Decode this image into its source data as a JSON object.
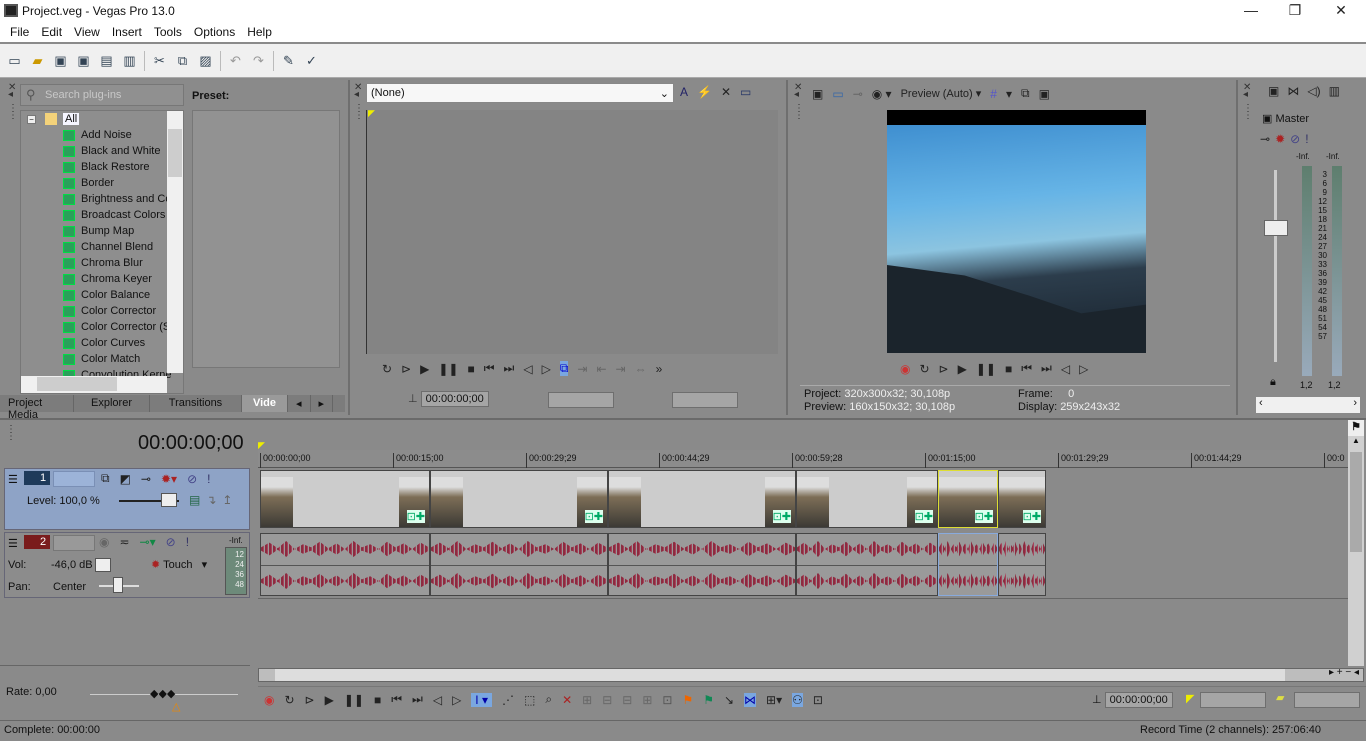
{
  "window": {
    "title": "Project.veg - Vegas Pro 13.0",
    "min": "—",
    "max": "❐",
    "close": "✕"
  },
  "menu": [
    "File",
    "Edit",
    "View",
    "Insert",
    "Tools",
    "Options",
    "Help"
  ],
  "toolbar_icons": [
    "new-icon",
    "open-icon",
    "save-icon",
    "save-as-icon",
    "render-icon",
    "properties-icon",
    "cut-icon",
    "copy-icon",
    "paste-icon",
    "undo-icon",
    "redo-icon",
    "enable-snapping-icon",
    "auto-ripple-icon"
  ],
  "plugins": {
    "search_placeholder": "Search plug-ins",
    "preset_label": "Preset:",
    "root": "All",
    "items": [
      "Add Noise",
      "Black and White",
      "Black Restore",
      "Border",
      "Brightness and Co",
      "Broadcast Colors",
      "Bump Map",
      "Channel Blend",
      "Chroma Blur",
      "Chroma Keyer",
      "Color Balance",
      "Color Corrector",
      "Color Corrector (S",
      "Color Curves",
      "Color Match",
      "Convolution Kerne"
    ]
  },
  "dock_tabs": [
    "Project Media",
    "Explorer",
    "Transitions",
    "Vide"
  ],
  "trimmer": {
    "selection": "(None)",
    "timecode": "00:00:00;00"
  },
  "preview": {
    "mode": "Preview (Auto)",
    "project_label": "Project:",
    "project": "320x300x32; 30,108p",
    "preview_label": "Preview:",
    "preview": "160x150x32; 30,108p",
    "frame_label": "Frame:",
    "frame": "0",
    "display_label": "Display:",
    "display": "259x243x32"
  },
  "master": {
    "label": "Master",
    "inf_left": "-Inf.",
    "inf_right": "-Inf.",
    "scale": [
      "3",
      "6",
      "9",
      "12",
      "15",
      "18",
      "21",
      "24",
      "27",
      "30",
      "33",
      "36",
      "39",
      "42",
      "45",
      "48",
      "51",
      "54",
      "57"
    ],
    "bottom_left": "1,2",
    "bottom_right": "1,2"
  },
  "timeline": {
    "cursor_time": "00:00:00;00",
    "ruler": [
      "00:00:00;00",
      "00:00:15;00",
      "00:00:29;29",
      "00:00:44;29",
      "00:00:59;28",
      "00:01:15;00",
      "00:01:29;29",
      "00:01:44;29",
      "00:0"
    ],
    "video_track": {
      "number": "1",
      "level": "Level: 100,0 %"
    },
    "audio_track": {
      "number": "2",
      "vol_label": "Vol:",
      "vol": "-46,0 dB",
      "pan_label": "Pan:",
      "pan": "Center",
      "automation": "Touch",
      "meter_inf": "-Inf.",
      "meter": [
        "12",
        "24",
        "36",
        "48"
      ]
    }
  },
  "rate": "Rate: 0,00",
  "transport_time": "00:00:00;00",
  "status": {
    "left": "Complete: 00:00:00",
    "right": "Record Time (2 channels): 257:06:40"
  }
}
